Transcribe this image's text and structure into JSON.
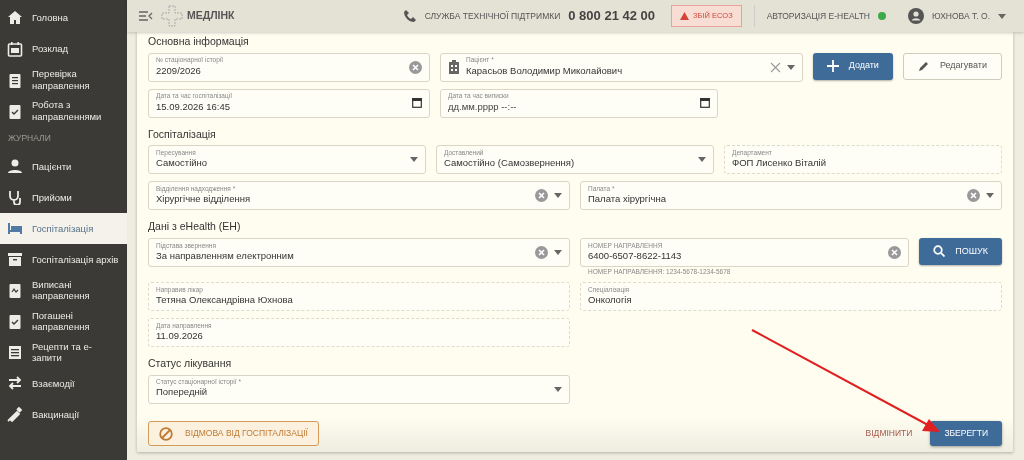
{
  "sidebar": {
    "items": [
      {
        "kind": "item",
        "label": "Головна",
        "selected": false
      },
      {
        "kind": "item",
        "label": "Розклад",
        "selected": false
      },
      {
        "kind": "item",
        "label": "Перевірка направлення",
        "selected": false
      },
      {
        "kind": "item",
        "label": "Робота з направленнями",
        "selected": false
      },
      {
        "kind": "header",
        "label": "ЖУРНАЛИ"
      },
      {
        "kind": "item",
        "label": "Пацієнти",
        "selected": false
      },
      {
        "kind": "item",
        "label": "Прийоми",
        "selected": false
      },
      {
        "kind": "item",
        "label": "Госпіталізація",
        "selected": true
      },
      {
        "kind": "item",
        "label": "Госпіталізація архів",
        "selected": false
      },
      {
        "kind": "item",
        "label": "Виписані направлення",
        "selected": false
      },
      {
        "kind": "item",
        "label": "Погашені направлення",
        "selected": false
      },
      {
        "kind": "item",
        "label": "Рецепти та е-запити",
        "selected": false
      },
      {
        "kind": "item",
        "label": "Взаємодії",
        "selected": false
      },
      {
        "kind": "item",
        "label": "Вакцинації",
        "selected": false
      }
    ]
  },
  "header": {
    "logo": "МЕДЛІНК",
    "support_label": "СЛУЖБА ТЕХНІЧНОЇ ПІДТРИМКИ",
    "support_phone": "0 800 21 42 00",
    "alert": "ЗБІЙ ЕСОЗ",
    "auth": {
      "label": "АВТОРИЗАЦІЯ E-HEALTH",
      "color": "#3daa4a"
    },
    "user": "ЮХНОВА Т. О."
  },
  "sections": [
    {
      "title": "Основна інформація",
      "rows": [
        [
          {
            "kind": "input",
            "label": "№ стаціонарної історії",
            "value": "2209/2026",
            "clear": true
          },
          {
            "kind": "patient",
            "label": "Пацієнт *",
            "value": "Карасьов Володимир Миколайович",
            "clear": true,
            "dropdown": true
          },
          {
            "kind": "add",
            "label": "Додати"
          },
          {
            "kind": "edit",
            "label": "Редагувати"
          }
        ],
        [
          {
            "kind": "datetime",
            "label": "Дата та час госпіталізації",
            "value": "15.09.2026 16:45"
          },
          {
            "kind": "datetime",
            "label": "Дата та час виписки",
            "placeholder": "дд.мм.рррр --:--"
          }
        ]
      ]
    },
    {
      "title": "Госпіталізація",
      "rows": [
        [
          {
            "kind": "select",
            "label": "Пересування",
            "value": "Самостійно",
            "dropdown": true
          },
          {
            "kind": "select",
            "label": "Доставлений",
            "value": "Самостійно (Самозвернення)",
            "dropdown": true
          },
          {
            "kind": "readonly",
            "label": "Департамент",
            "value": "ФОП Лисенко Віталій"
          }
        ],
        [
          {
            "kind": "select",
            "label": "Відділення надходження *",
            "value": "Хірургічне відділення",
            "clear": true,
            "dropdown": true
          },
          {
            "kind": "select",
            "label": "Палата *",
            "value": "Палата хірургічна",
            "clear": true,
            "dropdown": true
          }
        ]
      ]
    },
    {
      "title": "Дані з eHealth (ЕН)",
      "rows": [
        [
          {
            "kind": "select",
            "label": "Підстава звернення",
            "value": "За направленням електронним",
            "clear": true,
            "dropdown": true
          },
          {
            "kind": "input",
            "label": "НОМЕР НАПРАВЛЕННЯ",
            "value": "6400-6507-8622-1143",
            "clear": true,
            "hint": "НОМЕР НАПРАВЛЕННЯ: 1234-5678-1234-5678"
          },
          {
            "kind": "search",
            "label": "ПОШУК"
          }
        ],
        [
          {
            "kind": "readonly",
            "label": "Направив лікар",
            "value": "Тетяна Олександрівна Юхнова"
          },
          {
            "kind": "readonly",
            "label": "Спеціалізація",
            "value": "Онкологія"
          }
        ],
        [
          {
            "kind": "readonly",
            "label": "Дата направлення",
            "value": "11.09.2026"
          }
        ]
      ]
    },
    {
      "title": "Статус лікування",
      "rows": [
        [
          {
            "kind": "select",
            "label": "Статус стаціонарної історії *",
            "value": "Попередній",
            "dropdown": true
          }
        ]
      ]
    }
  ],
  "footer": {
    "refuse": "ВІДМОВА ВІД ГОСПІТАЛІЗАЦІЇ",
    "cancel": "ВІДМІНИТИ",
    "save": "ЗБЕРЕГТИ"
  },
  "annotation": {
    "kind": "arrow"
  }
}
